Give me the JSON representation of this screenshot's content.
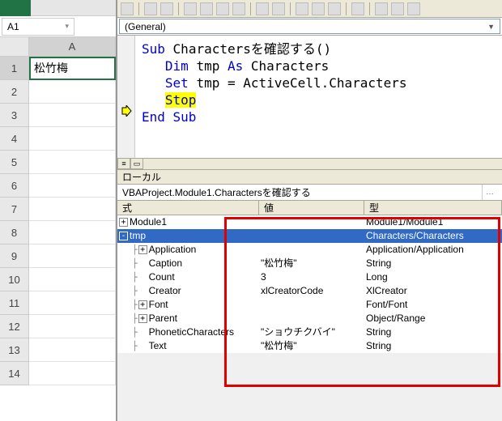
{
  "excel": {
    "namebox_value": "A1",
    "col_header": "A",
    "active_cell_value": "松竹梅",
    "row_headers": [
      "1",
      "2",
      "3",
      "4",
      "5",
      "6",
      "7",
      "8",
      "9",
      "10",
      "11",
      "12",
      "13",
      "14"
    ]
  },
  "vbe": {
    "object_dropdown": "(General)",
    "code_tokens": {
      "sub": "Sub",
      "proc_name": "Charactersを確認する()",
      "dim": "Dim",
      "var": "tmp",
      "as": "As",
      "type": "Characters",
      "set": "Set",
      "assign": "tmp = ActiveCell.Characters",
      "stop": "Stop",
      "end_sub": "End Sub"
    }
  },
  "locals": {
    "title": "ローカル",
    "context": "VBAProject.Module1.Charactersを確認する",
    "headers": {
      "expr": "式",
      "value": "値",
      "type": "型"
    },
    "rows": [
      {
        "icon": "+",
        "indent": 0,
        "expr": "Module1",
        "value": "",
        "type": "Module1/Module1",
        "selected": false
      },
      {
        "icon": "-",
        "indent": 0,
        "expr": "tmp",
        "value": "",
        "type": "Characters/Characters",
        "selected": true
      },
      {
        "icon": "+",
        "indent": 1,
        "expr": "Application",
        "value": "",
        "type": "Application/Application",
        "selected": false
      },
      {
        "icon": "",
        "indent": 1,
        "expr": "Caption",
        "value": "\"松竹梅\"",
        "type": "String",
        "selected": false
      },
      {
        "icon": "",
        "indent": 1,
        "expr": "Count",
        "value": "3",
        "type": "Long",
        "selected": false
      },
      {
        "icon": "",
        "indent": 1,
        "expr": "Creator",
        "value": "xlCreatorCode",
        "type": "XlCreator",
        "selected": false
      },
      {
        "icon": "+",
        "indent": 1,
        "expr": "Font",
        "value": "",
        "type": "Font/Font",
        "selected": false
      },
      {
        "icon": "+",
        "indent": 1,
        "expr": "Parent",
        "value": "",
        "type": "Object/Range",
        "selected": false
      },
      {
        "icon": "",
        "indent": 1,
        "expr": "PhoneticCharacters",
        "value": "\"ショウチクバイ\"",
        "type": "String",
        "selected": false
      },
      {
        "icon": "",
        "indent": 1,
        "expr": "Text",
        "value": "\"松竹梅\"",
        "type": "String",
        "selected": false
      }
    ]
  }
}
